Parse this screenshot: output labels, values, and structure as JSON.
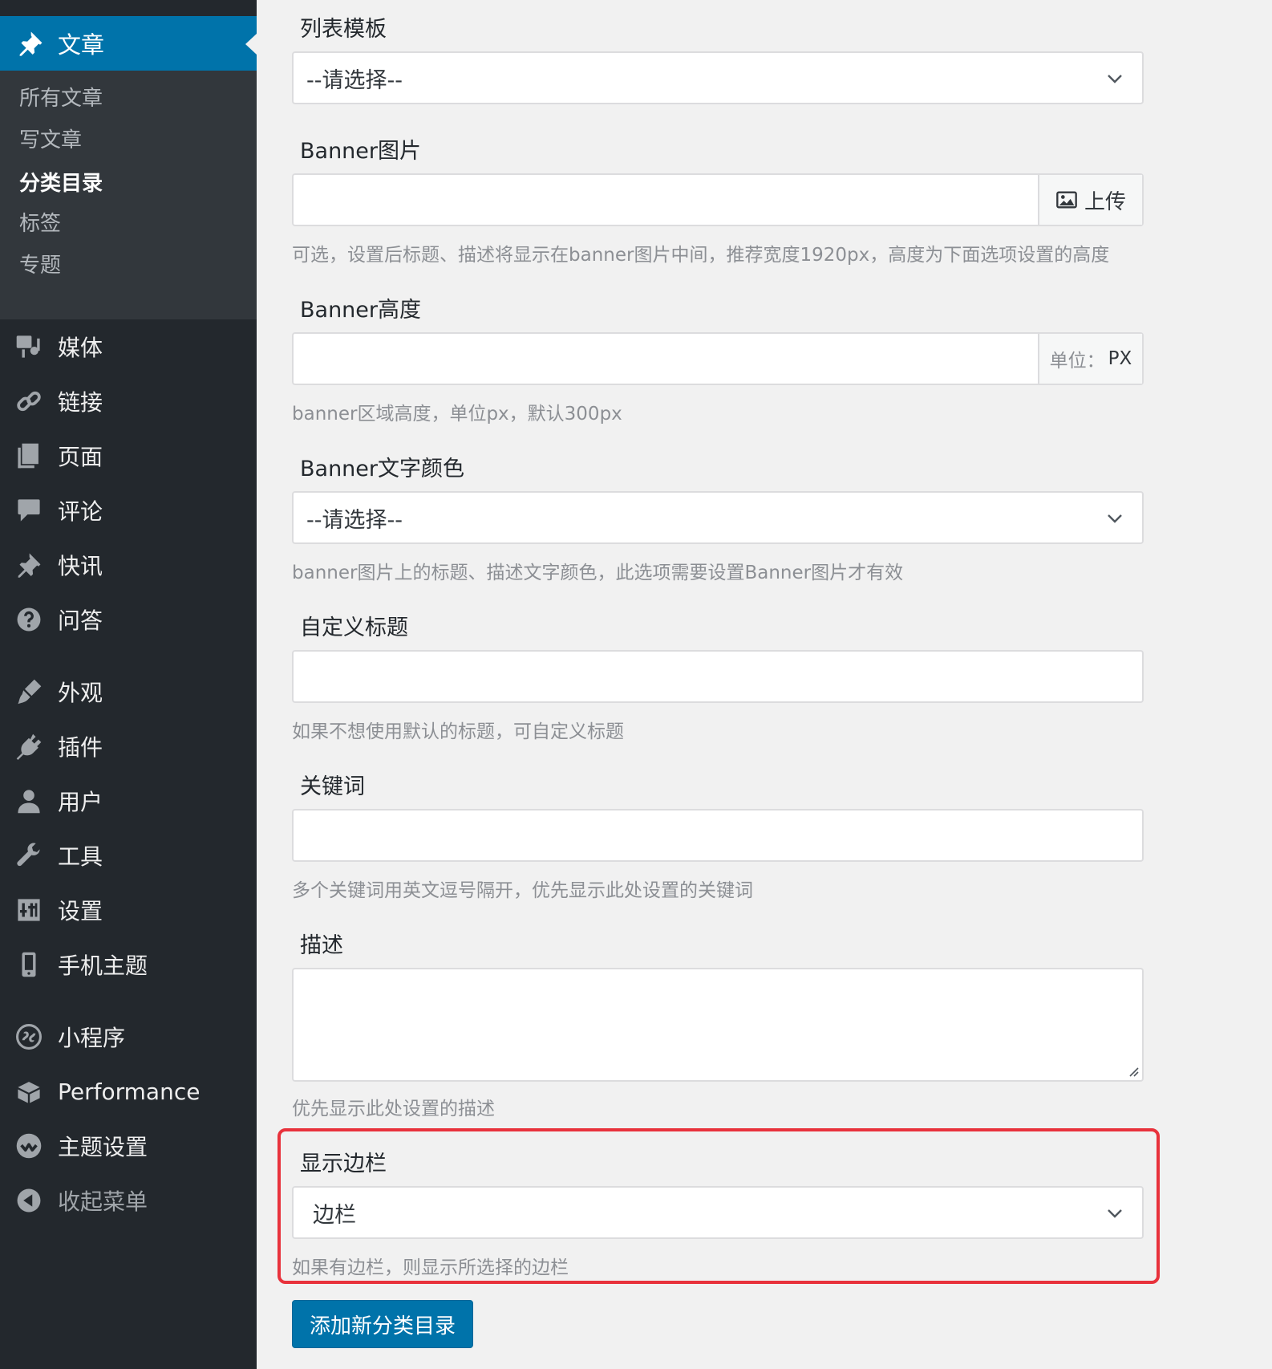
{
  "sidebar": {
    "current_menu": {
      "label": "文章",
      "icon": "pin-icon"
    },
    "submenu": [
      {
        "label": "所有文章"
      },
      {
        "label": "写文章"
      },
      {
        "label": "分类目录",
        "current": true
      },
      {
        "label": "标签"
      },
      {
        "label": "专题"
      }
    ],
    "menu": [
      {
        "label": "媒体",
        "icon": "media-icon"
      },
      {
        "label": "链接",
        "icon": "link-icon"
      },
      {
        "label": "页面",
        "icon": "page-icon"
      },
      {
        "label": "评论",
        "icon": "comment-icon"
      },
      {
        "label": "快讯",
        "icon": "pin-icon"
      },
      {
        "label": "问答",
        "icon": "question-icon"
      },
      {
        "label": "外观",
        "icon": "appearance-icon"
      },
      {
        "label": "插件",
        "icon": "plugin-icon"
      },
      {
        "label": "用户",
        "icon": "user-icon"
      },
      {
        "label": "工具",
        "icon": "wrench-icon"
      },
      {
        "label": "设置",
        "icon": "settings-icon"
      },
      {
        "label": "手机主题",
        "icon": "mobile-icon"
      },
      {
        "label": "小程序",
        "icon": "miniprogram-icon"
      },
      {
        "label": "Performance",
        "icon": "performance-icon"
      },
      {
        "label": "主题设置",
        "icon": "theme-settings-icon"
      },
      {
        "label": "收起菜单",
        "icon": "collapse-icon"
      }
    ]
  },
  "form": {
    "list_template": {
      "label": "列表模板",
      "value": "--请选择--"
    },
    "banner_image": {
      "label": "Banner图片",
      "upload_label": "上传",
      "desc": "可选，设置后标题、描述将显示在banner图片中间，推荐宽度1920px，高度为下面选项设置的高度"
    },
    "banner_height": {
      "label": "Banner高度",
      "unit_key": "单位：",
      "unit_value": "PX",
      "desc": "banner区域高度，单位px，默认300px"
    },
    "banner_text_color": {
      "label": "Banner文字颜色",
      "value": "--请选择--",
      "desc": "banner图片上的标题、描述文字颜色，此选项需要设置Banner图片才有效"
    },
    "custom_title": {
      "label": "自定义标题",
      "desc": "如果不想使用默认的标题，可自定义标题"
    },
    "keywords": {
      "label": "关键词",
      "desc": "多个关键词用英文逗号隔开，优先显示此处设置的关键词"
    },
    "description": {
      "label": "描述",
      "desc": "优先显示此处设置的描述"
    },
    "show_sidebar": {
      "label": "显示边栏",
      "value": "边栏",
      "desc": "如果有边栏，则显示所选择的边栏"
    },
    "submit_label": "添加新分类目录"
  },
  "colors": {
    "sidebar_bg": "#23282d",
    "submenu_bg": "#32373c",
    "accent": "#0073aa",
    "highlight": "#e8323c"
  }
}
